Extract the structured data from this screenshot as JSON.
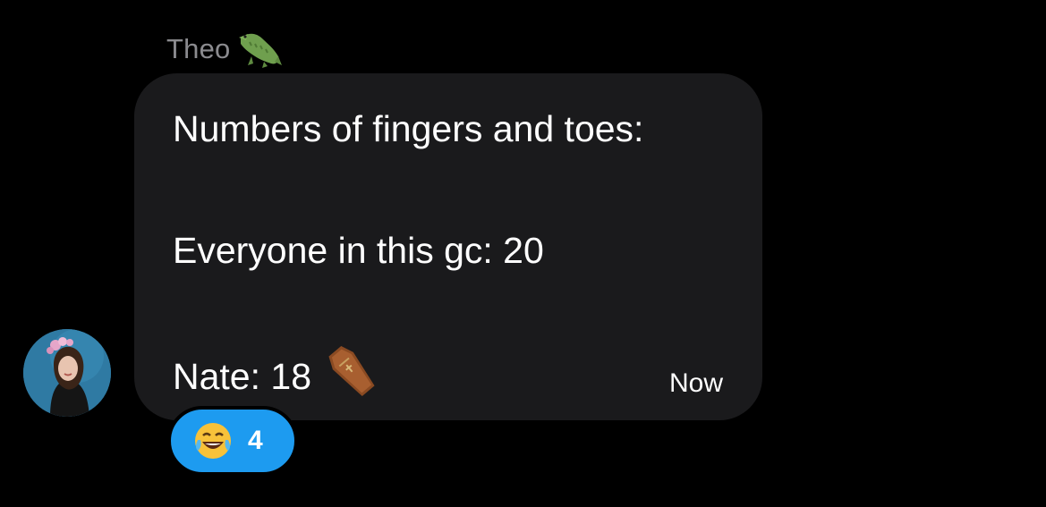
{
  "sender": {
    "name": "Theo",
    "emoji_icon": "crocodile-icon"
  },
  "message": {
    "lines": [
      "Numbers of fingers and toes:",
      "Everyone in this gc: 20",
      "Nate: 18"
    ],
    "trailing_emoji_icon": "coffin-icon",
    "timestamp": "Now",
    "bubble_color": "#1a1a1c"
  },
  "reaction": {
    "emoji_icon": "tears-of-joy-icon",
    "count": "4",
    "color": "#1d9bf0"
  },
  "colors": {
    "background": "#000000",
    "sender_name": "#8b8b8f",
    "text": "#ffffff"
  }
}
